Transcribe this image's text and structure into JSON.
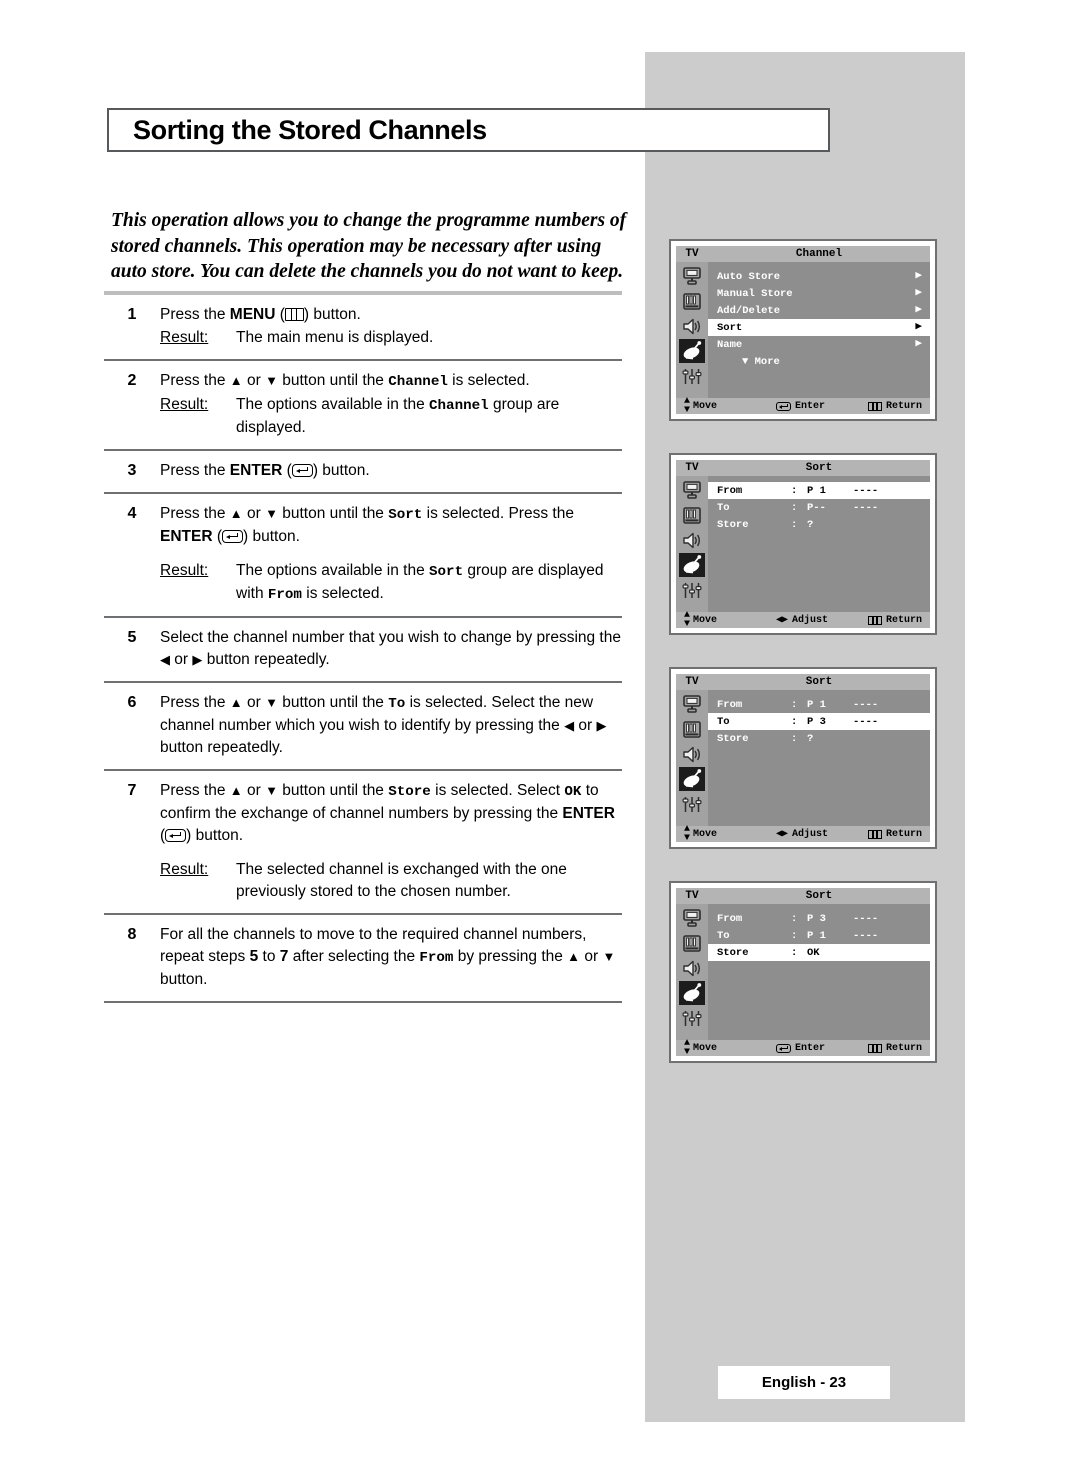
{
  "page": {
    "title": "Sorting the Stored Channels",
    "intro": "This operation allows you to change the programme numbers of stored channels. This operation may be necessary after using auto store. You can delete the channels you do not want to keep.",
    "footer": "English - 23"
  },
  "steps": [
    {
      "num": "1",
      "text_a": "Press the ",
      "key": "MENU",
      "icon": "menu-icon",
      "text_b": " button.",
      "result_label": "Result:",
      "result_text": "The main menu is displayed."
    },
    {
      "num": "2",
      "text": "Press the ▲ or ▼ button until the Channel is selected.",
      "result_label": "Result:",
      "result_text": "The options available in the Channel group are displayed."
    },
    {
      "num": "3",
      "text_a": "Press the ",
      "key": "ENTER",
      "icon": "enter-icon",
      "text_b": " button."
    },
    {
      "num": "4",
      "text": "Press the ▲ or ▼ button until the Sort is selected. Press the ENTER ( ) button.",
      "result_label": "Result:",
      "result_text": "The options available in the Sort group are displayed with From is selected."
    },
    {
      "num": "5",
      "text": "Select the channel number that you wish to change by pressing the ◀ or ▶ button repeatedly."
    },
    {
      "num": "6",
      "text": "Press the ▲ or ▼ button until the To is selected. Select the new channel number which you wish to identify by pressing the ◀ or ▶ button repeatedly."
    },
    {
      "num": "7",
      "text": "Press the ▲ or ▼ button until the Store is selected. Select OK to confirm the exchange of channel numbers by pressing the ENTER ( ) button.",
      "result_label": "Result:",
      "result_text": "The selected channel is exchanged with the one previously stored to the chosen number."
    },
    {
      "num": "8",
      "text": "For all the channels to move to the required channel numbers, repeat steps 5 to 7 after selecting the From by pressing the ▲ or ▼ button."
    }
  ],
  "step_words": {
    "press_the": "Press the ",
    "or": " or ",
    "menu": "MENU",
    "enter": "ENTER",
    "button_close": " button.",
    "paren_open": "(",
    "paren_close": ")",
    "s1_result": "The main menu is displayed.",
    "s2_a": "Press the ",
    "s2_b": " button until the ",
    "s2_chan": "Channel",
    "s2_c": " is selected.",
    "s2_r_a": "The options available in the ",
    "s2_r_b": " group are displayed.",
    "s4_a": "Press the ",
    "s4_b": " button until the ",
    "s4_sort": "Sort",
    "s4_c": " is selected. Press the ",
    "s4_r_a": "The options available in the ",
    "s4_r_b": " group are displayed with ",
    "s4_from": "From",
    "s4_r_c": " is selected.",
    "s5_a": "Select the channel number that you wish to change by pressing the ",
    "s5_b": " button repeatedly.",
    "s6_a": "Press the ",
    "s6_b": " button until the ",
    "s6_to": "To",
    "s6_c": " is selected. Select the new channel number which you wish to identify by pressing the ",
    "s6_d": " button repeatedly.",
    "s7_a": "Press the ",
    "s7_b": " button until the ",
    "s7_store": "Store",
    "s7_c": " is selected. Select ",
    "s7_ok": "OK",
    "s7_d": " to confirm the exchange of channel numbers by pressing the ",
    "s7_r": "The selected channel is exchanged with the one previously stored to the chosen number.",
    "s8_a": "For all the channels to move to the required channel numbers, repeat steps ",
    "s8_five": "5",
    "s8_to": " to ",
    "s8_seven": "7",
    "s8_b": " after selecting the ",
    "s8_from": "From",
    "s8_c": " by pressing the ",
    "s8_d": " button.",
    "result_label": "Result:"
  },
  "osd": {
    "tv_label": "TV",
    "rail_icons": [
      "picture-icon",
      "equalizer-icon",
      "speaker-icon",
      "satellite-dish-icon",
      "sliders-icon"
    ],
    "panels": [
      {
        "name": "channel-menu",
        "title": "Channel",
        "rows": [
          {
            "label": "Auto Store",
            "arrow": "▶",
            "selected": false
          },
          {
            "label": "Manual Store",
            "arrow": "▶",
            "selected": false
          },
          {
            "label": "Add/Delete",
            "arrow": "▶",
            "selected": false
          },
          {
            "label": "Sort",
            "arrow": "▶",
            "selected": true
          },
          {
            "label": "Name",
            "arrow": "▶",
            "selected": false
          }
        ],
        "more": "▼ More",
        "hints": [
          {
            "icon": "updown-icon",
            "label": "Move"
          },
          {
            "icon": "enter-icon",
            "label": "Enter"
          },
          {
            "icon": "menu-icon",
            "label": "Return"
          }
        ]
      },
      {
        "name": "sort-from-selected",
        "title": "Sort",
        "rows": [
          {
            "label": "From",
            "colon": ":",
            "value": "P 1",
            "dash": "----",
            "selected": true
          },
          {
            "label": "To",
            "colon": ":",
            "value": "P--",
            "dash": "----",
            "selected": false
          },
          {
            "label": "Store",
            "colon": ":",
            "value": "?",
            "dash": "",
            "selected": false
          }
        ],
        "hints": [
          {
            "icon": "updown-icon",
            "label": "Move"
          },
          {
            "icon": "leftright-icon",
            "label": "Adjust"
          },
          {
            "icon": "menu-icon",
            "label": "Return"
          }
        ]
      },
      {
        "name": "sort-to-selected",
        "title": "Sort",
        "rows": [
          {
            "label": "From",
            "colon": ":",
            "value": "P 1",
            "dash": "----",
            "selected": false
          },
          {
            "label": "To",
            "colon": ":",
            "value": "P 3",
            "dash": "----",
            "selected": true
          },
          {
            "label": "Store",
            "colon": ":",
            "value": "?",
            "dash": "",
            "selected": false
          }
        ],
        "hints": [
          {
            "icon": "updown-icon",
            "label": "Move"
          },
          {
            "icon": "leftright-icon",
            "label": "Adjust"
          },
          {
            "icon": "menu-icon",
            "label": "Return"
          }
        ]
      },
      {
        "name": "sort-store-ok",
        "title": "Sort",
        "rows": [
          {
            "label": "From",
            "colon": ":",
            "value": "P 3",
            "dash": "----",
            "selected": false
          },
          {
            "label": "To",
            "colon": ":",
            "value": "P 1",
            "dash": "----",
            "selected": false
          },
          {
            "label": "Store",
            "colon": ":",
            "value": "OK",
            "dash": "",
            "selected": true
          }
        ],
        "hints": [
          {
            "icon": "updown-icon",
            "label": "Move"
          },
          {
            "icon": "enter-icon",
            "label": "Enter"
          },
          {
            "icon": "menu-icon",
            "label": "Return"
          }
        ]
      }
    ]
  },
  "colors": {
    "panel_grey": "#cccccc",
    "osd_body": "#8e8e8e",
    "osd_bar": "#b4b4b4",
    "osd_rail": "#a2a2a2",
    "rule_thick": "#bdbdbd",
    "rule_thin": "#6f7072"
  }
}
